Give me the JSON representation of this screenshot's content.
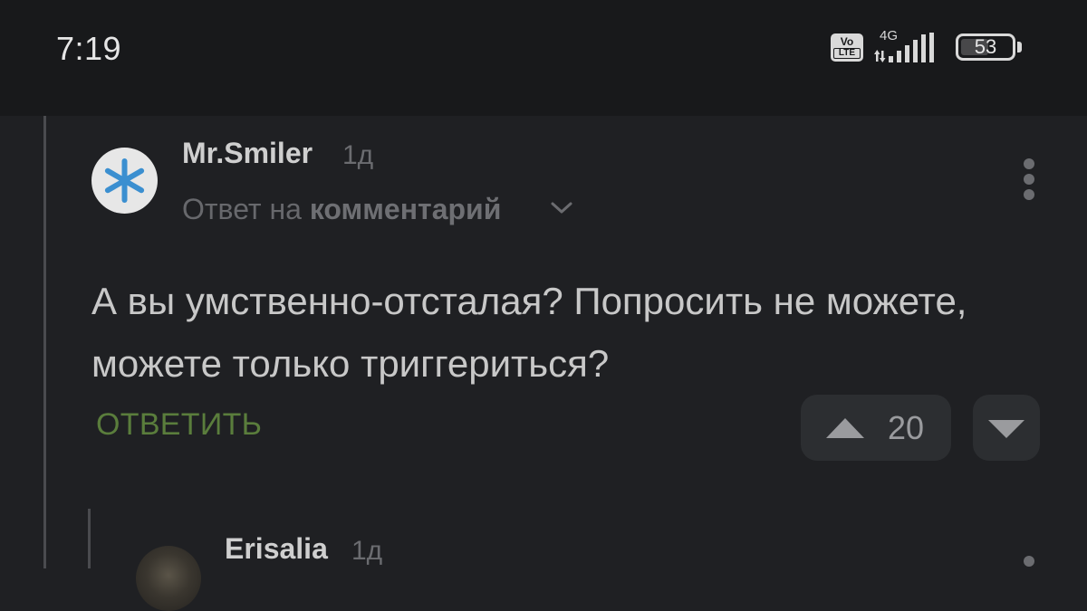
{
  "status_bar": {
    "time": "7:19",
    "volte_top": "Vo",
    "volte_bottom": "LTE",
    "network_type": "4G",
    "battery_level": "53"
  },
  "comment": {
    "author": "Mr.Smiler",
    "time_ago": "1д",
    "reply_prefix": "Ответ на",
    "reply_target": "комментарий",
    "text": "А вы умственно-отсталая? Попросить не можете, можете только триггериться?",
    "reply_button": "ОТВЕТИТЬ",
    "votes": "20"
  },
  "next_comment": {
    "author": "Erisalia",
    "time_ago": "1д"
  },
  "colors": {
    "background": "#1f2023",
    "status_bar": "#18191b",
    "reply_accent": "#5a7d3c",
    "avatar_star": "#3b8fd0"
  },
  "icons": {
    "avatar": "asterisk-icon",
    "expand": "chevron-down-icon",
    "menu": "more-vertical-icon",
    "upvote": "triangle-up-icon",
    "downvote": "triangle-down-icon"
  }
}
